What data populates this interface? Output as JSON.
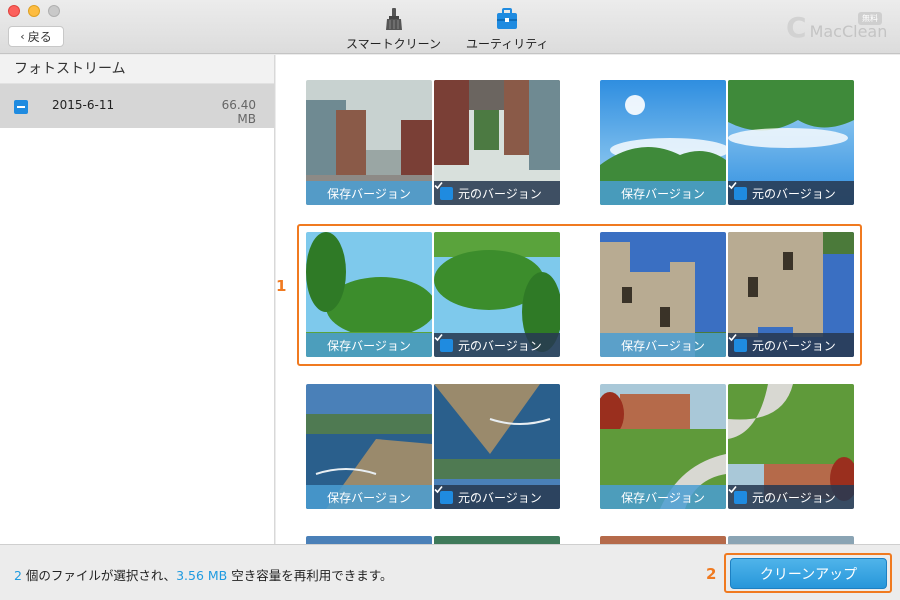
{
  "window": {
    "back_label": "戻る",
    "toolbar": [
      {
        "label": "スマートクリーン",
        "icon": "broom-icon"
      },
      {
        "label": "ユーティリティ",
        "icon": "toolbox-icon"
      }
    ],
    "brand_mark": "C",
    "brand_name": "MacClean",
    "badge": "無料"
  },
  "sidebar": {
    "title": "フォトストリーム",
    "items": [
      {
        "date": "2015-6-11",
        "size": "66.40 MB",
        "checked": "partial"
      }
    ]
  },
  "grid": {
    "saved_label": "保存バージョン",
    "original_label": "元のバージョン",
    "pairs": [
      {
        "scene": "street",
        "original_checked": true
      },
      {
        "scene": "sky-hills",
        "original_checked": true
      },
      {
        "scene": "trees",
        "original_checked": true
      },
      {
        "scene": "castle",
        "original_checked": true
      },
      {
        "scene": "beach",
        "original_checked": true
      },
      {
        "scene": "park",
        "original_checked": true
      }
    ],
    "callout_number": "1"
  },
  "footer": {
    "count": "2",
    "status_middle": " 個のファイルが選択され、",
    "size": "3.56 MB",
    "status_end": " 空き容量を再利用できます。",
    "cleanup_label": "クリーンアップ",
    "callout_number": "2"
  },
  "colors": {
    "accent": "#1f8be0",
    "highlight": "#f07a20",
    "saved_bar": "#4a9ed2",
    "original_bar": "#283a52"
  }
}
